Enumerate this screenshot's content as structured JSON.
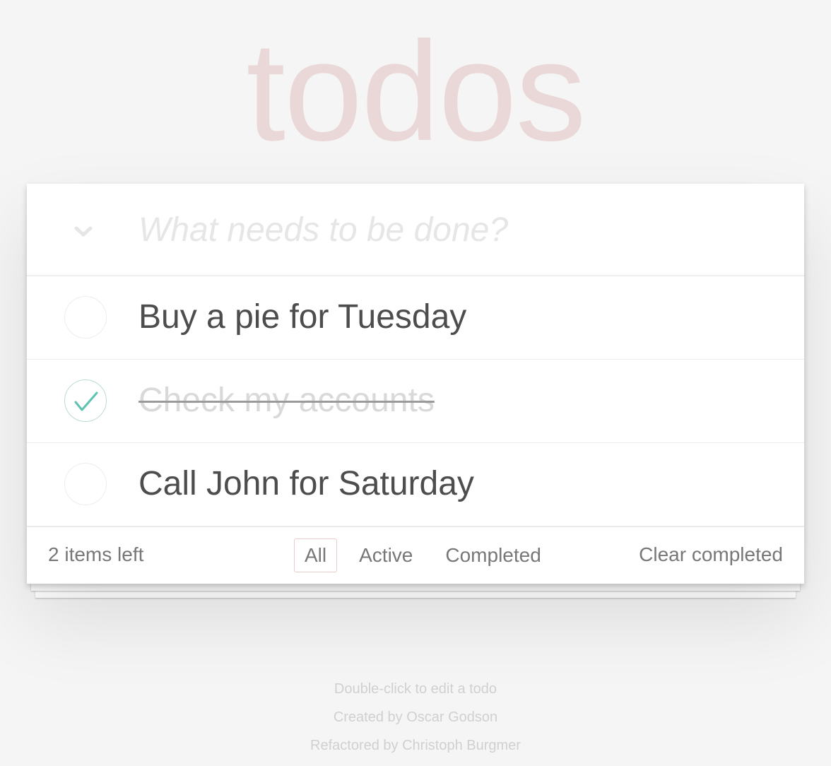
{
  "header": {
    "title": "todos"
  },
  "new_todo": {
    "placeholder": "What needs to be done?",
    "value": ""
  },
  "todos": [
    {
      "label": "Buy a pie for Tuesday",
      "completed": false
    },
    {
      "label": "Check my accounts",
      "completed": true
    },
    {
      "label": "Call John for Saturday",
      "completed": false
    }
  ],
  "footer": {
    "count_text": "2 items left",
    "filters": [
      {
        "label": "All",
        "selected": true
      },
      {
        "label": "Active",
        "selected": false
      },
      {
        "label": "Completed",
        "selected": false
      }
    ],
    "clear_label": "Clear completed"
  },
  "info": {
    "hint": "Double-click to edit a todo",
    "created_by": "Created by Oscar Godson",
    "refactored_by": "Refactored by Christoph Burgmer"
  },
  "colors": {
    "background": "#f5f5f5",
    "title": "rgba(175,47,47,0.15)",
    "check_green": "#5dc2af",
    "selected_filter_border": "rgba(175,47,47,0.25)"
  },
  "icons": {
    "toggle_all": "chevron-down-icon",
    "todo_checked": "checkmark-icon"
  }
}
